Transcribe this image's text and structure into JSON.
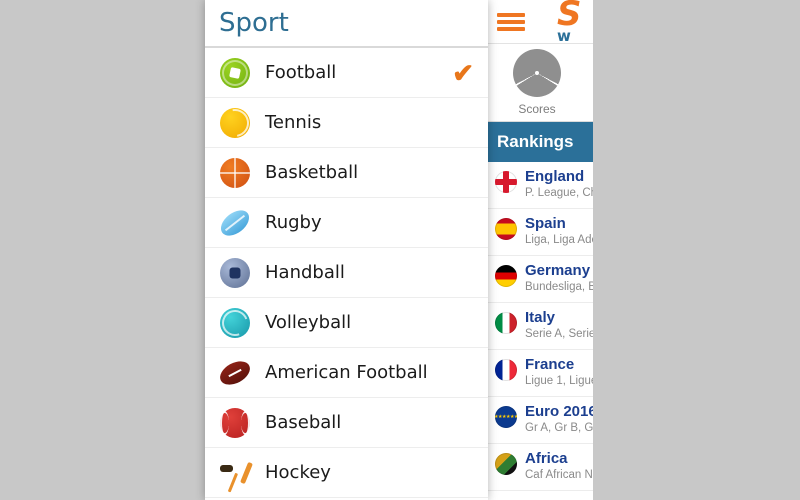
{
  "background_color": "#c8c8c8",
  "app": {
    "menu_icon": "hamburger-icon",
    "brand": {
      "mark": "S",
      "sub": "w"
    },
    "tabs": [
      {
        "label": "Scores",
        "icon": "pie-chart-icon"
      },
      {
        "label": "",
        "icon": "signal-icon"
      }
    ],
    "rankings_header": "Rankings",
    "rankings": [
      {
        "name": "England",
        "sub": "P. League, Cha",
        "flag": "england-flag-icon"
      },
      {
        "name": "Spain",
        "sub": "Liga, Liga Ade",
        "flag": "spain-flag-icon"
      },
      {
        "name": "Germany",
        "sub": "Bundesliga, B",
        "flag": "germany-flag-icon"
      },
      {
        "name": "Italy",
        "sub": "Serie A, Serie",
        "flag": "italy-flag-icon"
      },
      {
        "name": "France",
        "sub": "Ligue 1, Ligue",
        "flag": "france-flag-icon"
      },
      {
        "name": "Euro 2016",
        "sub": "Gr A, Gr B, Gr",
        "flag": "europe-flag-icon"
      },
      {
        "name": "Africa",
        "sub": "Caf African Na",
        "flag": "africa-flag-icon"
      }
    ],
    "colors": {
      "accent_orange": "#ef7622",
      "accent_blue": "#2b7099",
      "name_blue": "#1c3f8f"
    }
  },
  "sheet": {
    "title": "Sport",
    "title_color": "#2e6e92",
    "check_glyph": "✔",
    "check_color": "#e8761a",
    "sports": [
      {
        "label": "Football",
        "icon": "football-ball-icon",
        "selected": true
      },
      {
        "label": "Tennis",
        "icon": "tennis-ball-icon",
        "selected": false
      },
      {
        "label": "Basketball",
        "icon": "basketball-ball-icon",
        "selected": false
      },
      {
        "label": "Rugby",
        "icon": "rugby-ball-icon",
        "selected": false
      },
      {
        "label": "Handball",
        "icon": "handball-ball-icon",
        "selected": false
      },
      {
        "label": "Volleyball",
        "icon": "volleyball-ball-icon",
        "selected": false
      },
      {
        "label": "American Football",
        "icon": "american-football-ball-icon",
        "selected": false
      },
      {
        "label": "Baseball",
        "icon": "baseball-ball-icon",
        "selected": false
      },
      {
        "label": "Hockey",
        "icon": "hockey-stick-icon",
        "selected": false
      }
    ]
  }
}
